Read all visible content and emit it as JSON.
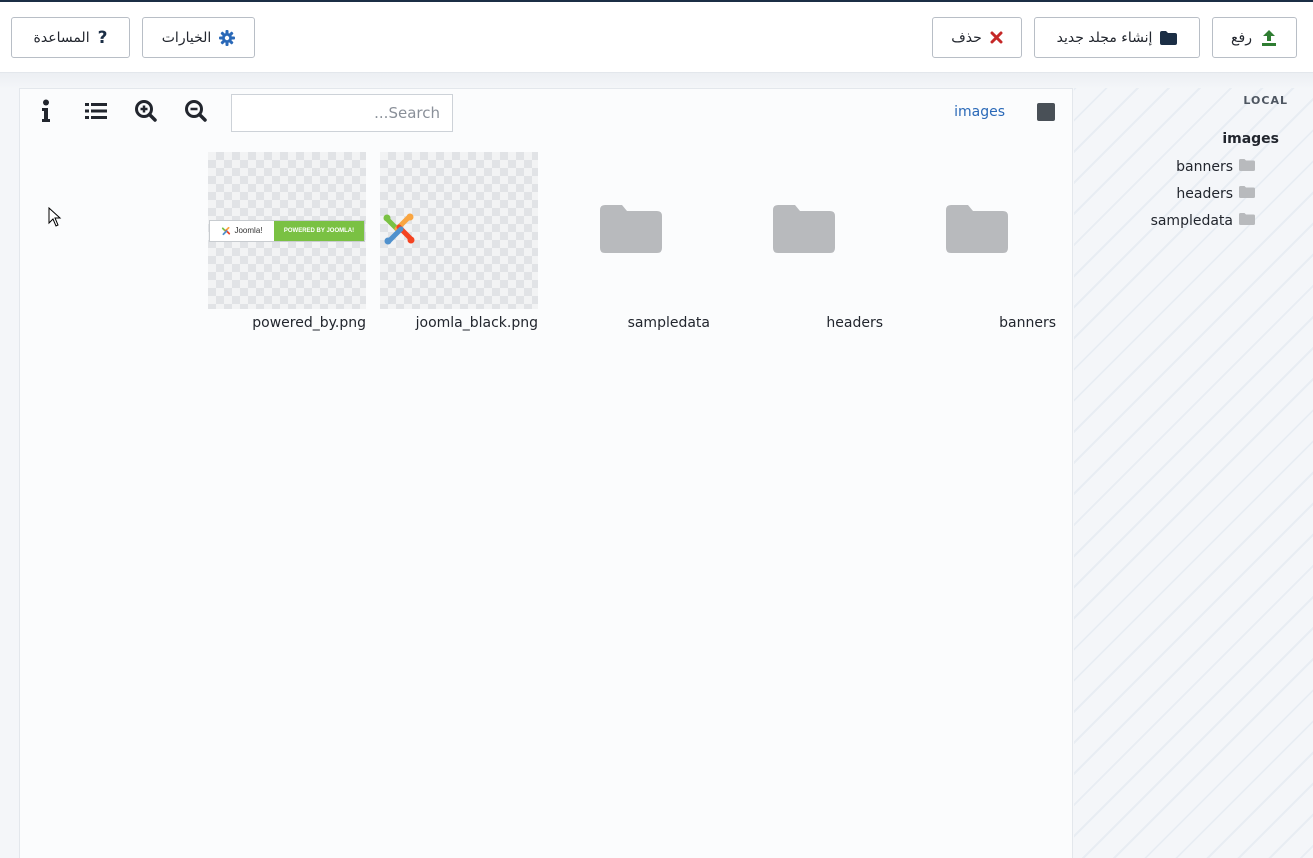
{
  "toolbar": {
    "upload_label": "رفع",
    "new_folder_label": "إنشاء مجلد جديد",
    "delete_label": "حذف",
    "options_label": "الخيارات",
    "help_label": "المساعدة"
  },
  "sidebar": {
    "title": "LOCAL",
    "root": "images",
    "items": [
      {
        "label": "banners"
      },
      {
        "label": "headers"
      },
      {
        "label": "sampledata"
      }
    ]
  },
  "main": {
    "breadcrumb": "images",
    "search": {
      "placeholder": "Search...",
      "value": ""
    },
    "items": [
      {
        "name": "banners",
        "type": "folder"
      },
      {
        "name": "headers",
        "type": "folder"
      },
      {
        "name": "sampledata",
        "type": "folder"
      },
      {
        "name": "joomla_black.png",
        "type": "image"
      },
      {
        "name": "powered_by.png",
        "type": "image"
      }
    ],
    "powered_logo": {
      "left": "Joomla!",
      "right": "POWERED BY JOOMLA!"
    }
  },
  "colors": {
    "upload_icon": "#2f7d32",
    "delete_icon": "#c52827",
    "options_icon": "#2a69b8",
    "folder": "#b8babd",
    "link": "#2a69b8",
    "joomla_green": "#7ac143"
  },
  "icons": {
    "upload": "upload-icon",
    "new_folder": "folder-icon",
    "delete": "times-icon",
    "options": "gear-icon",
    "help": "question-icon",
    "zoom_out": "zoom-out-icon",
    "zoom_in": "zoom-in-icon",
    "list": "list-icon",
    "info": "info-icon"
  }
}
